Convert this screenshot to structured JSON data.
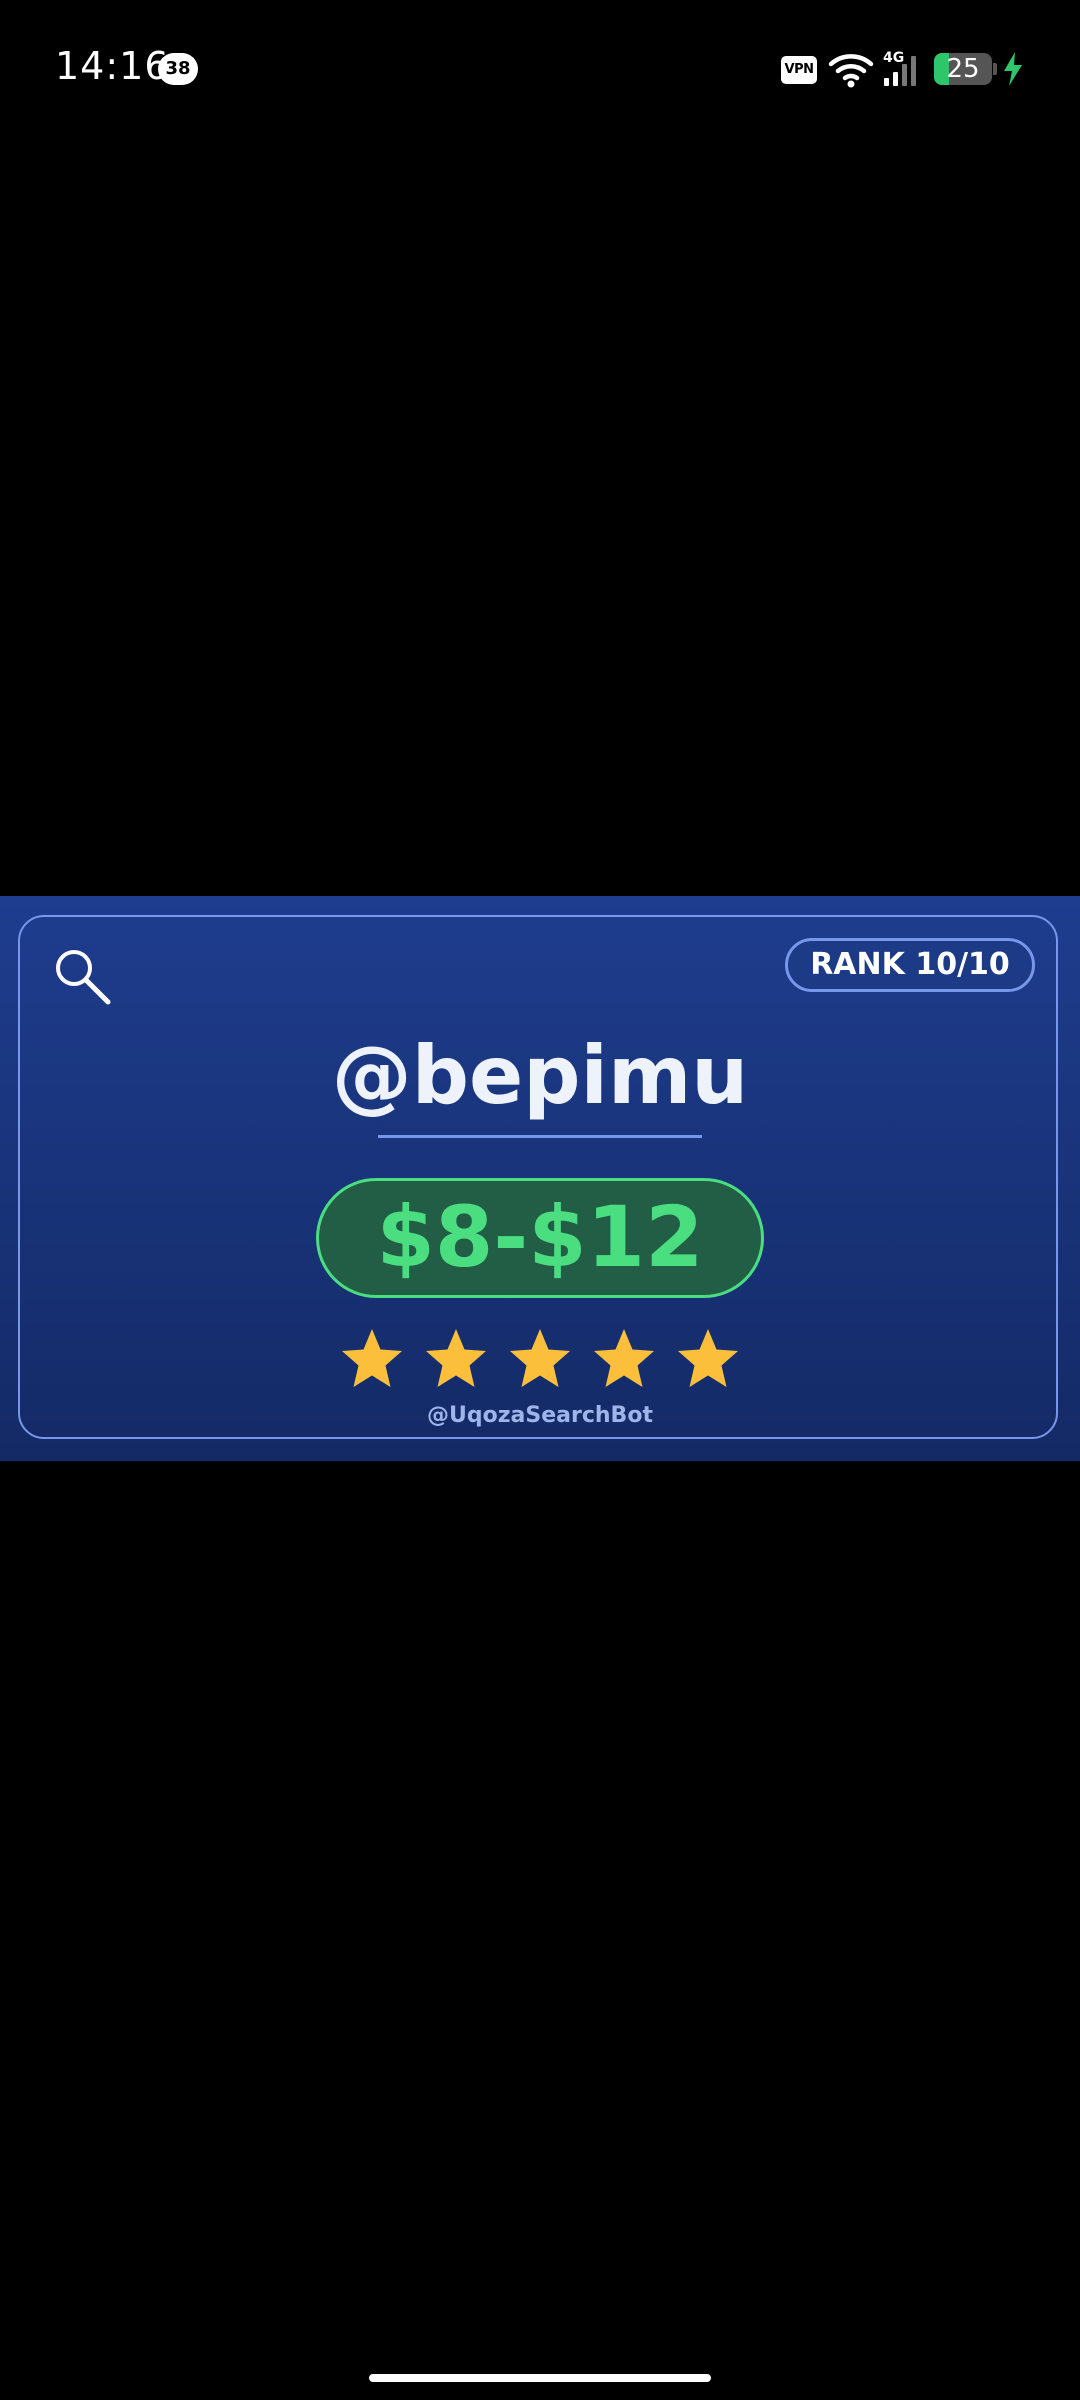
{
  "status_bar": {
    "time": "14:16",
    "notification_count": "38",
    "vpn_label": "VPN",
    "network_label": "4G",
    "battery_level": "25",
    "battery_fill_percent": 25,
    "charging": true
  },
  "card": {
    "rank_label": "RANK 10/10",
    "username": "@bepimu",
    "price_range": "$8-$12",
    "rating_stars": 5,
    "rating_max": 5,
    "bot_handle": "@UqozaSearchBot"
  },
  "colors": {
    "card_background": "#1e3d8e",
    "card_border": "#7896ea",
    "price_text": "#4ade80",
    "price_background": "#225e45",
    "star": "#fbbf3c",
    "battery_fill": "#2fc56a"
  },
  "icons": {
    "search": "search-icon",
    "star": "star-icon",
    "wifi": "wifi-icon",
    "signal": "signal-icon",
    "battery": "battery-icon",
    "charging": "charging-bolt-icon"
  }
}
